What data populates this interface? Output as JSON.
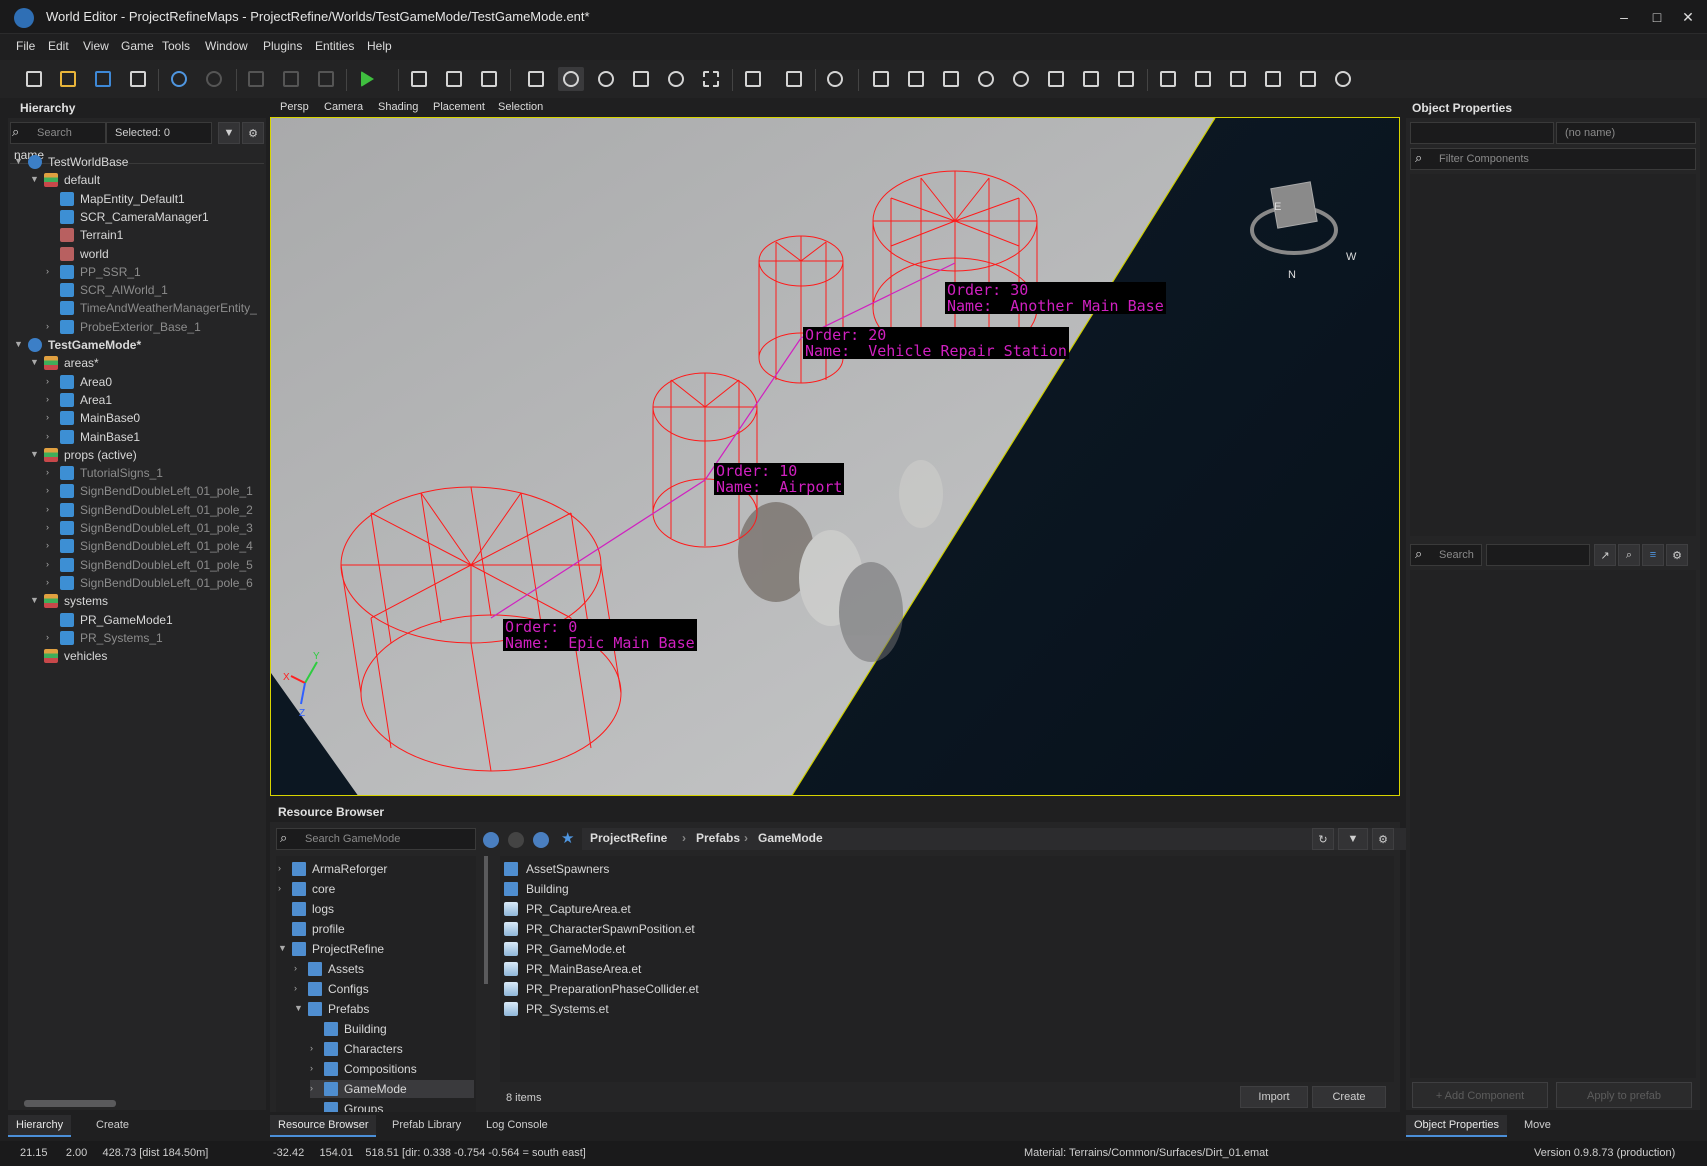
{
  "window": {
    "title": "World Editor - ProjectRefineMaps - ProjectRefine/Worlds/TestGameMode/TestGameMode.ent*",
    "controls": [
      "–",
      "□",
      "✕"
    ]
  },
  "menu": [
    "File",
    "Edit",
    "View",
    "Game",
    "Tools",
    "Window",
    "Plugins",
    "Entities",
    "Help"
  ],
  "hierarchy": {
    "title": "Hierarchy",
    "search_placeholder": "Search",
    "selected": "Selected: 0",
    "column": "name",
    "rows": [
      {
        "label": "TestWorldBase",
        "icon": "world-icon",
        "arrow": "▼",
        "indent": 0,
        "dim": false
      },
      {
        "label": "default",
        "icon": "layer-icon",
        "arrow": "▼",
        "indent": 1,
        "dim": false
      },
      {
        "label": "MapEntity_Default1",
        "icon": "entity-icon",
        "arrow": "",
        "indent": 2,
        "dim": false
      },
      {
        "label": "SCR_CameraManager1",
        "icon": "entity-icon",
        "arrow": "",
        "indent": 2,
        "dim": false
      },
      {
        "label": "Terrain1",
        "icon": "terrain-icon",
        "arrow": "",
        "indent": 2,
        "dim": false
      },
      {
        "label": "world",
        "icon": "terrain-icon",
        "arrow": "",
        "indent": 2,
        "dim": false
      },
      {
        "label": "PP_SSR_1",
        "icon": "entity-icon",
        "arrow": "›",
        "indent": 2,
        "dim": true
      },
      {
        "label": "SCR_AIWorld_1",
        "icon": "entity-icon",
        "arrow": "",
        "indent": 2,
        "dim": true
      },
      {
        "label": "TimeAndWeatherManagerEntity_",
        "icon": "entity-icon",
        "arrow": "",
        "indent": 2,
        "dim": true
      },
      {
        "label": "ProbeExterior_Base_1",
        "icon": "entity-icon",
        "arrow": "›",
        "indent": 2,
        "dim": true
      },
      {
        "label": "TestGameMode*",
        "icon": "world-icon",
        "arrow": "▼",
        "indent": 0,
        "dim": false,
        "bold": true
      },
      {
        "label": "areas*",
        "icon": "layer-icon",
        "arrow": "▼",
        "indent": 1,
        "dim": false
      },
      {
        "label": "Area0",
        "icon": "entity-icon",
        "arrow": "›",
        "indent": 2,
        "dim": false
      },
      {
        "label": "Area1",
        "icon": "entity-icon",
        "arrow": "›",
        "indent": 2,
        "dim": false
      },
      {
        "label": "MainBase0",
        "icon": "entity-icon",
        "arrow": "›",
        "indent": 2,
        "dim": false
      },
      {
        "label": "MainBase1",
        "icon": "entity-icon",
        "arrow": "›",
        "indent": 2,
        "dim": false
      },
      {
        "label": "props (active)",
        "icon": "layer-icon",
        "arrow": "▼",
        "indent": 1,
        "dim": false
      },
      {
        "label": "TutorialSigns_1",
        "icon": "entity-icon",
        "arrow": "›",
        "indent": 2,
        "dim": true
      },
      {
        "label": "SignBendDoubleLeft_01_pole_1",
        "icon": "entity-icon",
        "arrow": "›",
        "indent": 2,
        "dim": true
      },
      {
        "label": "SignBendDoubleLeft_01_pole_2",
        "icon": "entity-icon",
        "arrow": "›",
        "indent": 2,
        "dim": true
      },
      {
        "label": "SignBendDoubleLeft_01_pole_3",
        "icon": "entity-icon",
        "arrow": "›",
        "indent": 2,
        "dim": true
      },
      {
        "label": "SignBendDoubleLeft_01_pole_4",
        "icon": "entity-icon",
        "arrow": "›",
        "indent": 2,
        "dim": true
      },
      {
        "label": "SignBendDoubleLeft_01_pole_5",
        "icon": "entity-icon",
        "arrow": "›",
        "indent": 2,
        "dim": true
      },
      {
        "label": "SignBendDoubleLeft_01_pole_6",
        "icon": "entity-icon",
        "arrow": "›",
        "indent": 2,
        "dim": true
      },
      {
        "label": "systems",
        "icon": "layer-icon",
        "arrow": "▼",
        "indent": 1,
        "dim": false
      },
      {
        "label": "PR_GameMode1",
        "icon": "entity-icon",
        "arrow": "",
        "indent": 2,
        "dim": false
      },
      {
        "label": "PR_Systems_1",
        "icon": "entity-icon",
        "arrow": "›",
        "indent": 2,
        "dim": true
      },
      {
        "label": "vehicles",
        "icon": "layer-icon",
        "arrow": "",
        "indent": 1,
        "dim": false
      }
    ],
    "tabs": [
      "Hierarchy",
      "Create"
    ]
  },
  "viewport": {
    "tabs": [
      "Persp",
      "Camera",
      "Shading",
      "Placement",
      "Selection"
    ],
    "labels": [
      {
        "order": "Order: 30",
        "name": "Name:  Another Main Base"
      },
      {
        "order": "Order: 20",
        "name": "Name:  Vehicle Repair Station"
      },
      {
        "order": "Order: 10",
        "name": "Name:  Airport"
      },
      {
        "order": "Order: 0",
        "name": "Name:  Epic Main Base"
      }
    ],
    "gizmo_letters": [
      "E",
      "N",
      "W"
    ],
    "axis_letters": [
      "Y",
      "X",
      "Z"
    ]
  },
  "resource_browser": {
    "title": "Resource Browser",
    "search_placeholder": "Search GameMode",
    "breadcrumb": [
      "ProjectRefine",
      "Prefabs",
      "GameMode"
    ],
    "tree": [
      {
        "label": "ArmaReforger",
        "arrow": "›",
        "indent": 0
      },
      {
        "label": "core",
        "arrow": "›",
        "indent": 0
      },
      {
        "label": "logs",
        "arrow": "",
        "indent": 0
      },
      {
        "label": "profile",
        "arrow": "",
        "indent": 0
      },
      {
        "label": "ProjectRefine",
        "arrow": "▼",
        "indent": 0
      },
      {
        "label": "Assets",
        "arrow": "›",
        "indent": 1
      },
      {
        "label": "Configs",
        "arrow": "›",
        "indent": 1
      },
      {
        "label": "Prefabs",
        "arrow": "▼",
        "indent": 1
      },
      {
        "label": "Building",
        "arrow": "",
        "indent": 2
      },
      {
        "label": "Characters",
        "arrow": "›",
        "indent": 2
      },
      {
        "label": "Compositions",
        "arrow": "›",
        "indent": 2
      },
      {
        "label": "GameMode",
        "arrow": "›",
        "indent": 2,
        "selected": true
      },
      {
        "label": "Groups",
        "arrow": "",
        "indent": 2
      }
    ],
    "files": [
      {
        "label": "AssetSpawners",
        "type": "folder"
      },
      {
        "label": "Building",
        "type": "folder"
      },
      {
        "label": "PR_CaptureArea.et",
        "type": "file"
      },
      {
        "label": "PR_CharacterSpawnPosition.et",
        "type": "file"
      },
      {
        "label": "PR_GameMode.et",
        "type": "file"
      },
      {
        "label": "PR_MainBaseArea.et",
        "type": "file"
      },
      {
        "label": "PR_PreparationPhaseCollider.et",
        "type": "file"
      },
      {
        "label": "PR_Systems.et",
        "type": "file"
      }
    ],
    "item_count": "8 items",
    "import_label": "Import",
    "create_label": "Create",
    "tabs": [
      "Resource Browser",
      "Prefab Library",
      "Log Console"
    ]
  },
  "object_properties": {
    "title": "Object Properties",
    "name_placeholder": "(no name)",
    "filter_placeholder": "Filter Components",
    "search_placeholder": "Search",
    "add_component": "+ Add Component",
    "apply_prefab": "Apply to prefab",
    "tabs": [
      "Object Properties",
      "Move"
    ]
  },
  "status": {
    "left_coords": "21.15      2.00     428.73 [dist 184.50m]",
    "mid_coords": "-32.42     154.01    518.51 [dir: 0.338 -0.754 -0.564 = south east]",
    "material": "Material: Terrains/Common/Surfaces/Dirt_01.emat",
    "version": "Version 0.9.8.73 (production)"
  },
  "colors": {
    "accent": "#4b8fd8",
    "viewport_border": "#d7d400",
    "wireframe": "#ff2020",
    "label_text": "#d020c0"
  }
}
